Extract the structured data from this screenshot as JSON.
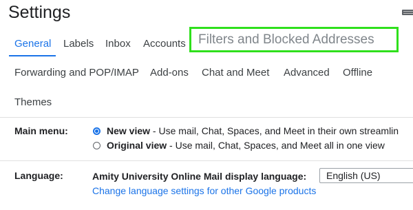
{
  "header": {
    "title": "Settings"
  },
  "tabs": [
    {
      "label": "General",
      "active": true
    },
    {
      "label": "Labels"
    },
    {
      "label": "Inbox"
    },
    {
      "label": "Accounts"
    },
    {
      "label": "Filters and Blocked Addresses",
      "highlighted": true
    },
    {
      "label": "Forwarding and POP/IMAP"
    },
    {
      "label": "Add-ons"
    },
    {
      "label": "Chat and Meet"
    },
    {
      "label": "Advanced"
    },
    {
      "label": "Offline"
    },
    {
      "label": "Themes"
    }
  ],
  "main_menu": {
    "label": "Main menu:",
    "options": [
      {
        "name": "New view",
        "description": " - Use mail, Chat, Spaces, and Meet in their own streamlin",
        "selected": true
      },
      {
        "name": "Original view",
        "description": " - Use mail, Chat, Spaces, and Meet all in one view",
        "selected": false
      }
    ]
  },
  "language": {
    "label": "Language:",
    "display_label": "Amity University Online Mail display language:",
    "selected": "English (US)",
    "link": "Change language settings for other Google products"
  },
  "colors": {
    "accent": "#1a73e8",
    "highlight_border": "#2fe01c"
  },
  "icons": {
    "keyboard": "keyboard-icon"
  }
}
